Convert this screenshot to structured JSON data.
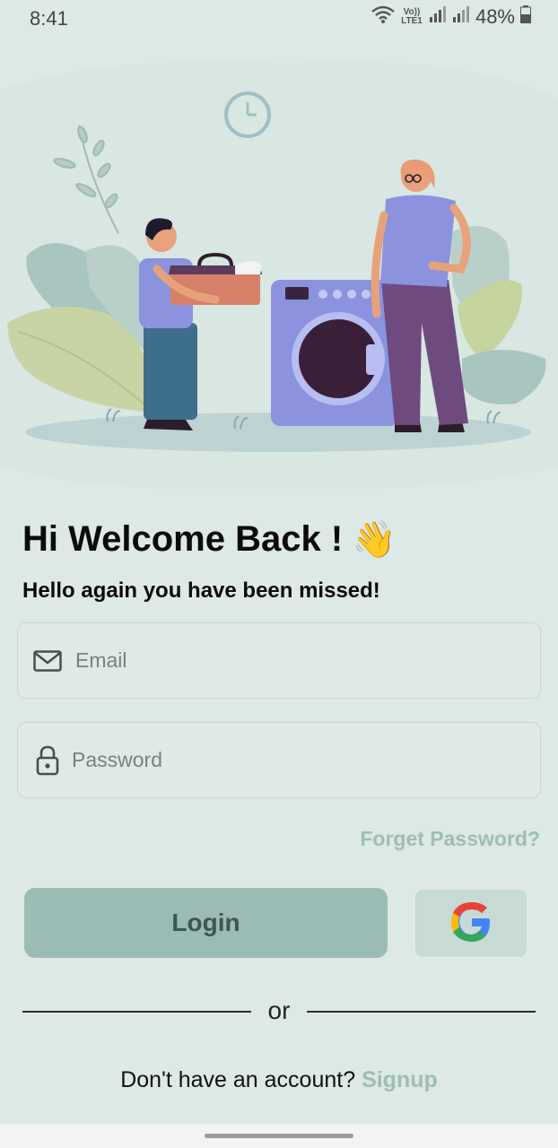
{
  "status": {
    "time": "8:41",
    "network": "Vo)) LTE1",
    "battery": "48%",
    "icons": [
      "wifi-icon",
      "signal-icon",
      "signal-icon",
      "battery-icon"
    ]
  },
  "hero": {
    "illustration": "laundry-illustration"
  },
  "welcome": {
    "title": "Hi Welcome Back !",
    "emoji": "👋",
    "subtitle": "Hello again you have been missed!"
  },
  "form": {
    "email": {
      "value": "",
      "placeholder": "Email",
      "icon": "mail-icon"
    },
    "password": {
      "value": "",
      "placeholder": "Password",
      "icon": "lock-icon"
    },
    "forgot_label": "Forget Password?",
    "login_label": "Login",
    "google_icon": "google-icon"
  },
  "divider": {
    "label": "or"
  },
  "signup": {
    "prompt": "Don't have an account?",
    "link_label": "Signup"
  },
  "colors": {
    "background": "#dde9e5",
    "accent": "#9ebdb7",
    "login_button": "#9bbbb5",
    "google_button": "#c6dad6"
  }
}
